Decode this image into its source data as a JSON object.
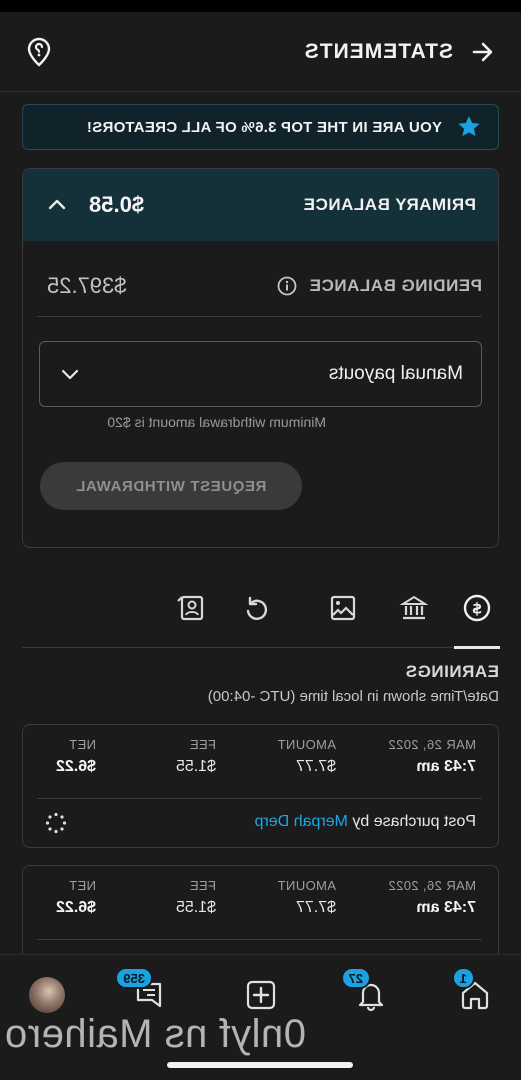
{
  "header": {
    "title": "STATEMENTS",
    "back_icon": "arrow-left-icon",
    "help_icon": "help-location-icon"
  },
  "banner": {
    "text": "YOU ARE IN THE TOP 3.6% OF ALL CREATORS!",
    "icon": "star-icon",
    "accent": "#1aa3e0"
  },
  "balance": {
    "primary_label": "PRIMARY BALANCE",
    "primary_amount": "$0.58",
    "pending_label": "PENDING BALANCE",
    "pending_amount": "$397.25",
    "payout_select": "Manual payouts",
    "min_note": "Minimum withdrawal amount is $20",
    "request_button": "REQUEST WITHDRAWAL"
  },
  "tabs": [
    {
      "name": "earnings",
      "icon": "dollar-circle-icon",
      "active": true
    },
    {
      "name": "bank",
      "icon": "bank-icon",
      "active": false
    },
    {
      "name": "media",
      "icon": "image-icon",
      "active": false
    },
    {
      "name": "refunds",
      "icon": "redo-arrow-icon",
      "active": false
    },
    {
      "name": "referrals",
      "icon": "contact-card-icon",
      "active": false
    }
  ],
  "earnings": {
    "heading": "EARNINGS",
    "timezone_note": "Date/Time shown in local time (UTC -04:00)",
    "columns": {
      "date": "MAR 26, 2022",
      "amount": "AMOUNT",
      "fee": "FEE",
      "net": "NET"
    },
    "rows": [
      {
        "date": "MAR 26, 2022",
        "time": "7:43 am",
        "amount": "$7.77",
        "fee": "$1.55",
        "net": "$6.22",
        "desc_prefix": "Post purchase by",
        "user": "Merpah Derp"
      },
      {
        "date": "MAR 26, 2022",
        "time": "7:43 am",
        "amount": "$7.77",
        "fee": "$1.55",
        "net": "$6.22"
      }
    ]
  },
  "bottom_nav": {
    "home_badge": "1",
    "notifications_badge": "27",
    "messages_badge": "359"
  },
  "watermark": "0nlyf ns Maihero"
}
